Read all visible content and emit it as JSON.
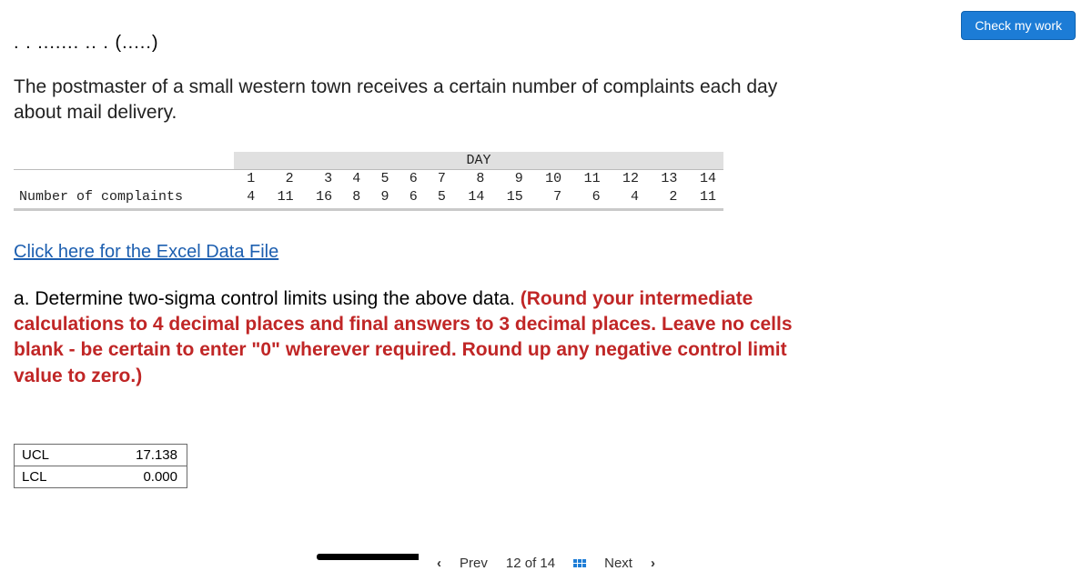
{
  "header": {
    "check_label": "Check my work",
    "truncated": ". . ....... .. . (.....)"
  },
  "prompt": "The postmaster of a small western town receives a certain number of complaints each day about mail delivery.",
  "table": {
    "day_label": "DAY",
    "row_label": "Number of complaints",
    "days": [
      "1",
      "2",
      "3",
      "4",
      "5",
      "6",
      "7",
      "8",
      "9",
      "10",
      "11",
      "12",
      "13",
      "14"
    ],
    "values": [
      "4",
      "11",
      "16",
      "8",
      "9",
      "6",
      "5",
      "14",
      "15",
      "7",
      "6",
      "4",
      "2",
      "11"
    ]
  },
  "excel_link": "Click here for the Excel Data File",
  "question": {
    "lead": "a. Determine two-sigma control limits using the above data. ",
    "instr": "(Round your intermediate calculations to 4 decimal places and final answers to 3 decimal places. Leave no cells blank - be certain to enter \"0\" wherever required. Round up any negative control limit value to zero.)"
  },
  "answers": {
    "ucl_label": "UCL",
    "ucl_value": "17.138",
    "lcl_label": "LCL",
    "lcl_value": "0.000"
  },
  "nav": {
    "prev": "Prev",
    "pos": "12 of 14",
    "next": "Next"
  }
}
